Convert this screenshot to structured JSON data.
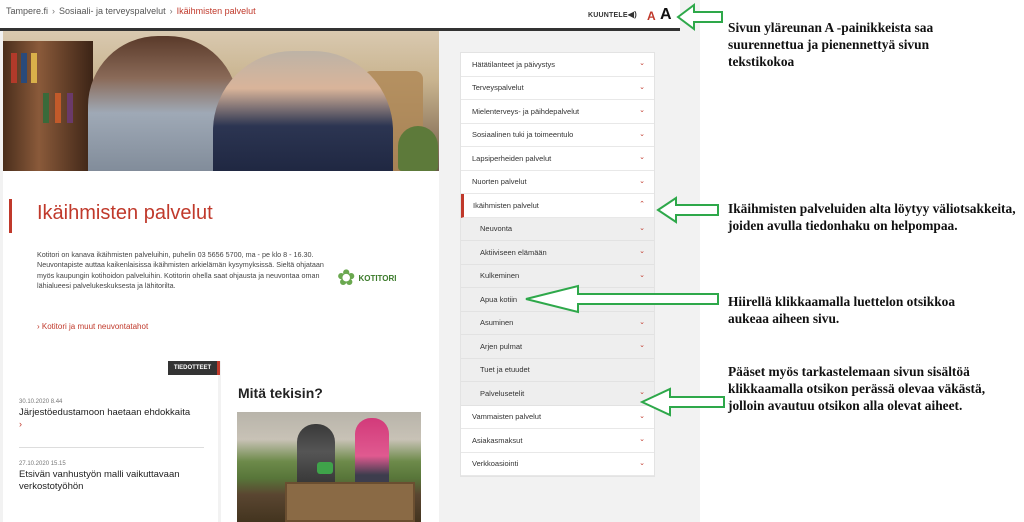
{
  "breadcrumb": [
    "Tampere.fi",
    "Sosiaali- ja terveyspalvelut",
    "Ikäihmisten palvelut"
  ],
  "header": {
    "listen_label": "KUUNTELE",
    "font_small": "A",
    "font_large": "A"
  },
  "intro": {
    "title": "Ikäihmisten palvelut",
    "text": "Kotitori on kanava ikäihmisten palveluihin, puhelin 03 5656 5700, ma - pe klo 8 - 16.30. Neuvontapiste auttaa kaikenlaisissa ikäihmisten arkielämän kysymyksissä. Sieltä ohjataan myös kaupungin kotihoidon palveluihin. Kotitorin ohella saat ohjausta ja neuvontaa oman lähialueesi palvelukeskuksesta ja lähitorilta.",
    "link": "Kotitori ja muut neuvontatahot",
    "logo_text": "KOTITORI"
  },
  "news": {
    "badge": "TIEDOTTEET",
    "items": [
      {
        "date": "30.10.2020 8.44",
        "title": "Järjestöedustamoon haetaan ehdokkaita"
      },
      {
        "date": "27.10.2020 15.15",
        "title": "Etsivän vanhustyön malli vaikuttavaan verkostotyöhön"
      }
    ]
  },
  "mita": {
    "title": "Mitä tekisin?"
  },
  "nav": {
    "items": [
      {
        "label": "Hätätilanteet ja päivystys"
      },
      {
        "label": "Terveyspalvelut"
      },
      {
        "label": "Mielenterveys- ja päihdepalvelut"
      },
      {
        "label": "Sosiaalinen tuki ja toimeentulo"
      },
      {
        "label": "Lapsiperheiden palvelut"
      },
      {
        "label": "Nuorten palvelut"
      },
      {
        "label": "Ikäihmisten palvelut"
      },
      {
        "label": "Neuvonta"
      },
      {
        "label": "Aktiiviseen elämään"
      },
      {
        "label": "Kulkeminen"
      },
      {
        "label": "Apua kotiin"
      },
      {
        "label": "Asuminen"
      },
      {
        "label": "Arjen pulmat"
      },
      {
        "label": "Tuet ja etuudet"
      },
      {
        "label": "Palvelusetelit"
      },
      {
        "label": "Vammaisten palvelut"
      },
      {
        "label": "Asiakasmaksut"
      },
      {
        "label": "Verkkoasiointi"
      }
    ]
  },
  "annotations": [
    "Sivun yläreunan A -painikkeista saa suurennettua ja pienennettyä sivun tekstikokoa",
    "Ikäihmisten palveluiden alta löytyy väliotsakkeita, joiden avulla tiedonhaku on helpompaa.",
    "Hiirellä klikkaamalla luettelon otsikkoa aukeaa aiheen sivu.",
    "Pääset myös tarkastelemaan sivun sisältöä klikkaamalla otsikon perässä olevaa väkästä, jolloin avautuu otsikon alla olevat aiheet."
  ],
  "colors": {
    "accent": "#c0392b",
    "arrow": "#2ea84a",
    "logo": "#6aa84f"
  }
}
